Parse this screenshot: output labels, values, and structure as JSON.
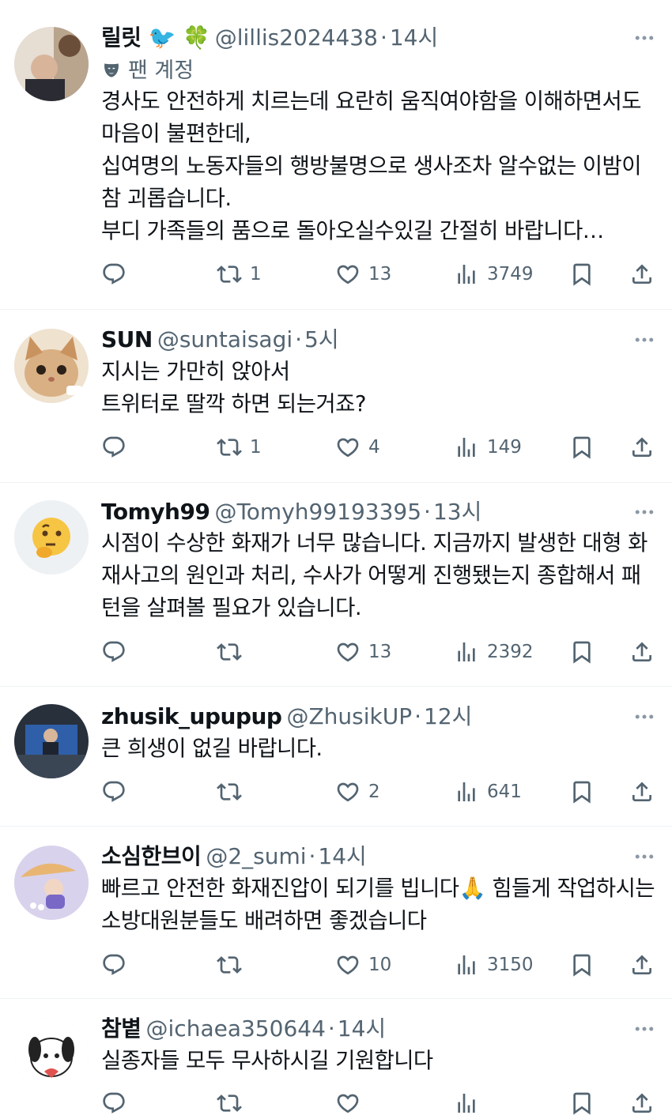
{
  "tweets": [
    {
      "name": "릴릿 🐦 🍀",
      "handle": "@lillis2024438",
      "time": "14시",
      "fan_label": "팬 계정",
      "text": "경사도 안전하게 치르는데 요란히 움직여야함을 이해하면서도 마음이 불편한데,\n십여명의 노동자들의 행방불명으로 생사조차 알수없는 이밤이 참 괴롭습니다.\n부디 가족들의 품으로 돌아오실수있길 간절히 바랍니다…",
      "retweets": "1",
      "likes": "13",
      "views": "3749"
    },
    {
      "name": "SUN",
      "handle": "@suntaisagi",
      "time": "5시",
      "text": "지시는 가만히 앉아서\n트위터로 딸깍 하면 되는거죠?",
      "retweets": "1",
      "likes": "4",
      "views": "149"
    },
    {
      "name": "Tomyh99",
      "handle": "@Tomyh99193395",
      "time": "13시",
      "text": "시점이 수상한 화재가 너무 많습니다. 지금까지 발생한 대형 화재사고의 원인과 처리, 수사가 어떻게 진행됐는지 종합해서 패턴을 살펴볼 필요가 있습니다.",
      "retweets": "",
      "likes": "13",
      "views": "2392"
    },
    {
      "name": "zhusik_upupup",
      "handle": "@ZhusikUP",
      "time": "12시",
      "text": "큰 희생이 없길 바랍니다.",
      "retweets": "",
      "likes": "2",
      "views": "641"
    },
    {
      "name": "소심한브이",
      "handle": "@2_sumi",
      "time": "14시",
      "text": "빠르고 안전한 화재진압이 되기를 빕니다🙏 힘들게 작업하시는 소방대원분들도 배려하면 좋겠습니다",
      "retweets": "",
      "likes": "10",
      "views": "3150"
    },
    {
      "name": "참볕",
      "handle": "@ichaea350644",
      "time": "14시",
      "text": "실종자들 모두 무사하시길 기원합니다",
      "retweets": "",
      "likes": "",
      "views": ""
    }
  ],
  "separator": "·",
  "icons": [
    "reply-icon",
    "retweet-icon",
    "like-icon",
    "views-icon",
    "bookmark-icon",
    "share-icon",
    "more-icon"
  ],
  "colors": {
    "text": "#0f1419",
    "secondary": "#536471",
    "divider": "#eff3f4"
  }
}
